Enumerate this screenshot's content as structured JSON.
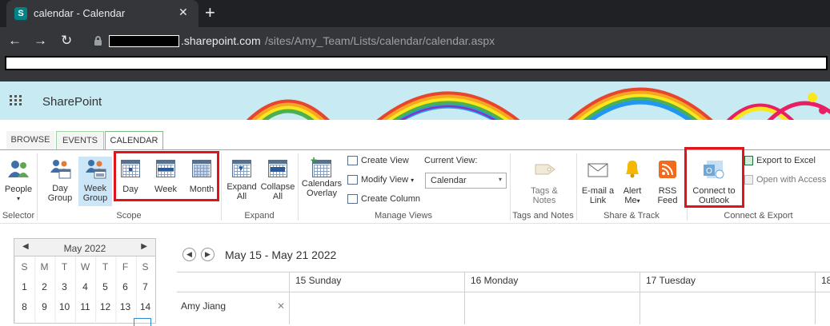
{
  "browser": {
    "tab_title": "calendar - Calendar",
    "favicon_letter": "S",
    "tab_close": "✕",
    "new_tab": "+",
    "back": "←",
    "forward": "→",
    "reload": "↻",
    "url_host": ".sharepoint.com",
    "url_path": "/sites/Amy_Team/Lists/calendar/calendar.aspx"
  },
  "suite": {
    "brand": "SharePoint"
  },
  "ribbon_tabs": [
    "BROWSE",
    "EVENTS",
    "CALENDAR"
  ],
  "ribbon": {
    "selector": {
      "people_label": "People",
      "people_arrow": "▾",
      "group": "Selector"
    },
    "scope": {
      "day_group": [
        "Day",
        "Group"
      ],
      "week_group": [
        "Week",
        "Group"
      ],
      "day": "Day",
      "week": "Week",
      "month": "Month",
      "group": "Scope"
    },
    "expand": {
      "expand_all": [
        "Expand",
        "All"
      ],
      "collapse_all": [
        "Collapse",
        "All"
      ],
      "group": "Expand"
    },
    "manage_views": {
      "calendars_overlay": [
        "Calendars",
        "Overlay"
      ],
      "create_view": "Create View",
      "modify_view": "Modify View",
      "modify_arrow": "▾",
      "create_column": "Create Column",
      "current_view_label": "Current View:",
      "current_view_value": "Calendar",
      "current_view_arrow": "▾",
      "group": "Manage Views"
    },
    "tags_notes": {
      "tags_notes": [
        "Tags &",
        "Notes"
      ],
      "group": "Tags and Notes"
    },
    "share_track": {
      "email_link": [
        "E-mail a",
        "Link"
      ],
      "alert_me": [
        "Alert",
        "Me"
      ],
      "alert_arrow": "▾",
      "rss_feed": [
        "RSS",
        "Feed"
      ],
      "group": "Share & Track"
    },
    "connect_export": {
      "connect_outlook": [
        "Connect to",
        "Outlook"
      ],
      "export_excel": "Export to Excel",
      "open_access": "Open with Access",
      "group": "Connect & Export"
    }
  },
  "mini_calendar": {
    "month": "May 2022",
    "prev": "◀",
    "next": "▶",
    "weekdays": [
      "S",
      "M",
      "T",
      "W",
      "T",
      "F",
      "S"
    ],
    "rows": [
      [
        "1",
        "2",
        "3",
        "4",
        "5",
        "6",
        "7"
      ],
      [
        "8",
        "9",
        "10",
        "11",
        "12",
        "13",
        "14"
      ]
    ]
  },
  "week_view": {
    "prev": "◀",
    "next": "▶",
    "date_range": "May 15 - May 21 2022",
    "days": [
      "15 Sunday",
      "16 Monday",
      "17 Tuesday",
      "18"
    ],
    "person": "Amy Jiang",
    "person_remove": "✕"
  },
  "colors": {
    "ribbon_green": "#7bbf82",
    "highlight_red": "#e0151c",
    "suite_bg": "#c8eaf3",
    "selected_bg": "#cde6f7"
  }
}
